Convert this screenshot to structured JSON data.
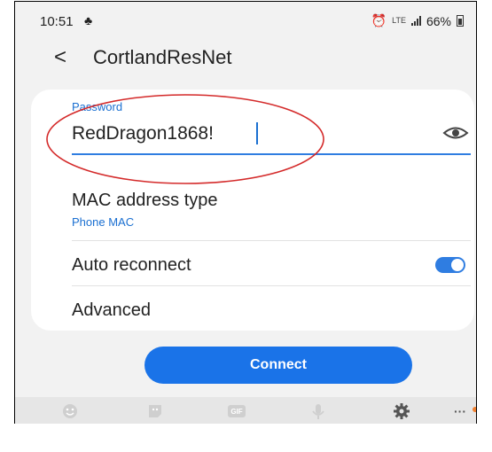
{
  "status_bar": {
    "time": "10:51",
    "network": "LTE",
    "battery": "66%"
  },
  "header": {
    "back_glyph": "<",
    "title": "CortlandResNet"
  },
  "password": {
    "label": "Password",
    "value": "RedDragon1868!"
  },
  "mac": {
    "title": "MAC address type",
    "value": "Phone MAC"
  },
  "auto_reconnect": {
    "label": "Auto reconnect",
    "enabled": true
  },
  "advanced": {
    "label": "Advanced"
  },
  "connect": {
    "label": "Connect"
  },
  "keyboard_toolbar": {
    "icons": [
      "emoji-icon",
      "sticker-icon",
      "gif-icon",
      "mic-icon",
      "settings-icon",
      "more-icon"
    ],
    "gif_label": "GIF"
  },
  "colors": {
    "accent": "#1a73e8",
    "label_blue": "#1a6fd1",
    "annotation": "#d42a2a",
    "toolbar_bg": "#e6e6e6"
  }
}
